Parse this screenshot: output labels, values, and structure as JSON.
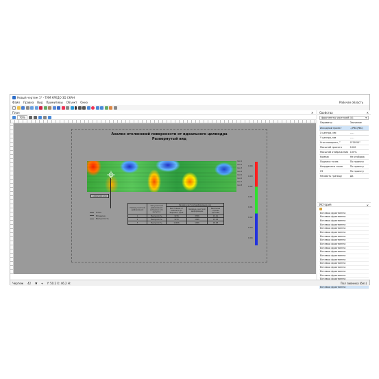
{
  "window": {
    "title": "Новый чертеж 1* - ТИМ КРЕДО 3D СКАН"
  },
  "menu": [
    "Файл",
    "Правка",
    "Вид",
    "Примитивы",
    "Объект",
    "Окно"
  ],
  "workspace_label": "Рабочая область",
  "toolbar_icons": [
    "new-icon",
    "open-icon",
    "save-icon",
    "print-icon",
    "undo-icon",
    "redo-icon",
    "cut-icon",
    "copy-icon",
    "paste-icon",
    "select-icon",
    "move-icon",
    "rotate-icon",
    "scale-icon",
    "mirror-icon",
    "text-icon",
    "line-icon",
    "polyline-icon",
    "rect-icon",
    "circle-icon",
    "arc-icon",
    "hatch-icon",
    "dim-icon",
    "layer-icon",
    "props-icon"
  ],
  "plan": {
    "tab_label": "План",
    "zoom": "70%",
    "drawing_title_1": "Анализ отклонений поверхности от идеального цилиндра",
    "drawing_title_2": "Развернутый вид",
    "scale_ref": "1000/100 mm",
    "legend": [
      "План",
      "Впадина",
      "Выпуклость"
    ],
    "scale_values": [
      "0.04",
      "0.03",
      "0.02",
      "0.01",
      "0.01",
      "0.02",
      "0.03",
      "0.04"
    ],
    "row_labels": [
      "поя 1",
      "поя 2",
      "поя 3",
      "поя 4",
      "поя 5",
      "поя 6",
      "поя 7",
      "поя 8"
    ],
    "table": {
      "headers": [
        "Номер участкой деформации",
        "Тип участкой деформации (впадина или выпукл.)",
        "Расстояние от нижнего до верхнего края",
        "Ширина участкой деформации",
        "Величина стрелы прогиба"
      ],
      "group_header": "Размер участкой деформации, мм",
      "rows": [
        [
          "1",
          "Выпуклость",
          "3215",
          "3356",
          "13.41"
        ],
        [
          "2",
          "Выпуклость",
          "3215",
          "1096",
          "13.44"
        ],
        [
          "3",
          "Выпуклость",
          "11066",
          "1096",
          "18.08"
        ]
      ]
    }
  },
  "properties": {
    "title": "Свойства",
    "filter": "фрагменты чертежей (4)",
    "col_param": "Параметр",
    "col_value": "Значение",
    "rows": [
      [
        "Исходный проект",
        "..\\PBC\\PBC\\"
      ],
      [
        "X центра, мм",
        "-.-.-"
      ],
      [
        "Y центра, мм",
        "-.-.-"
      ],
      [
        "Угол поворота, °",
        "0°00'00\""
      ],
      [
        "Масштаб проекта",
        "1000"
      ],
      [
        "Масштаб отображения",
        "100%"
      ],
      [
        "Компас",
        "Не отображ"
      ],
      [
        "Подписи точек",
        "По проекту"
      ],
      [
        "Координаты точек",
        "По проекту"
      ],
      [
        "УЗ",
        "По проекту"
      ],
      [
        "Рисовать границу",
        "Да"
      ]
    ]
  },
  "history": {
    "title": "История",
    "items": [
      "Вставка фрагмента",
      "Вставка фрагмента",
      "Вставка фрагмента",
      "Вставка фрагмента",
      "Вставка фрагмента",
      "Вставка фрагмента",
      "Вставка фрагмента",
      "Вставка фрагмента",
      "Вставка фрагмента",
      "Вставка фрагмента",
      "Вставка фрагмента",
      "Вставка фрагмента",
      "Вставка фрагмента",
      "Вставка фрагмента",
      "Вставка фрагмента",
      "Вставка фрагмента",
      "Вставка фрагмента",
      "Вставка фрагмента",
      "Вставка фрагмента",
      "Вставка фрагмента"
    ]
  },
  "status": {
    "tab": "Чертеж",
    "count": "42",
    "coords": "Y: 50.2  X: 46.2  H:",
    "page_label": "Пол ливника (без)"
  },
  "colors": {
    "accent": "#2f6fc9",
    "canvas": "#9a9a9a",
    "selection": "#cfe3f7"
  }
}
